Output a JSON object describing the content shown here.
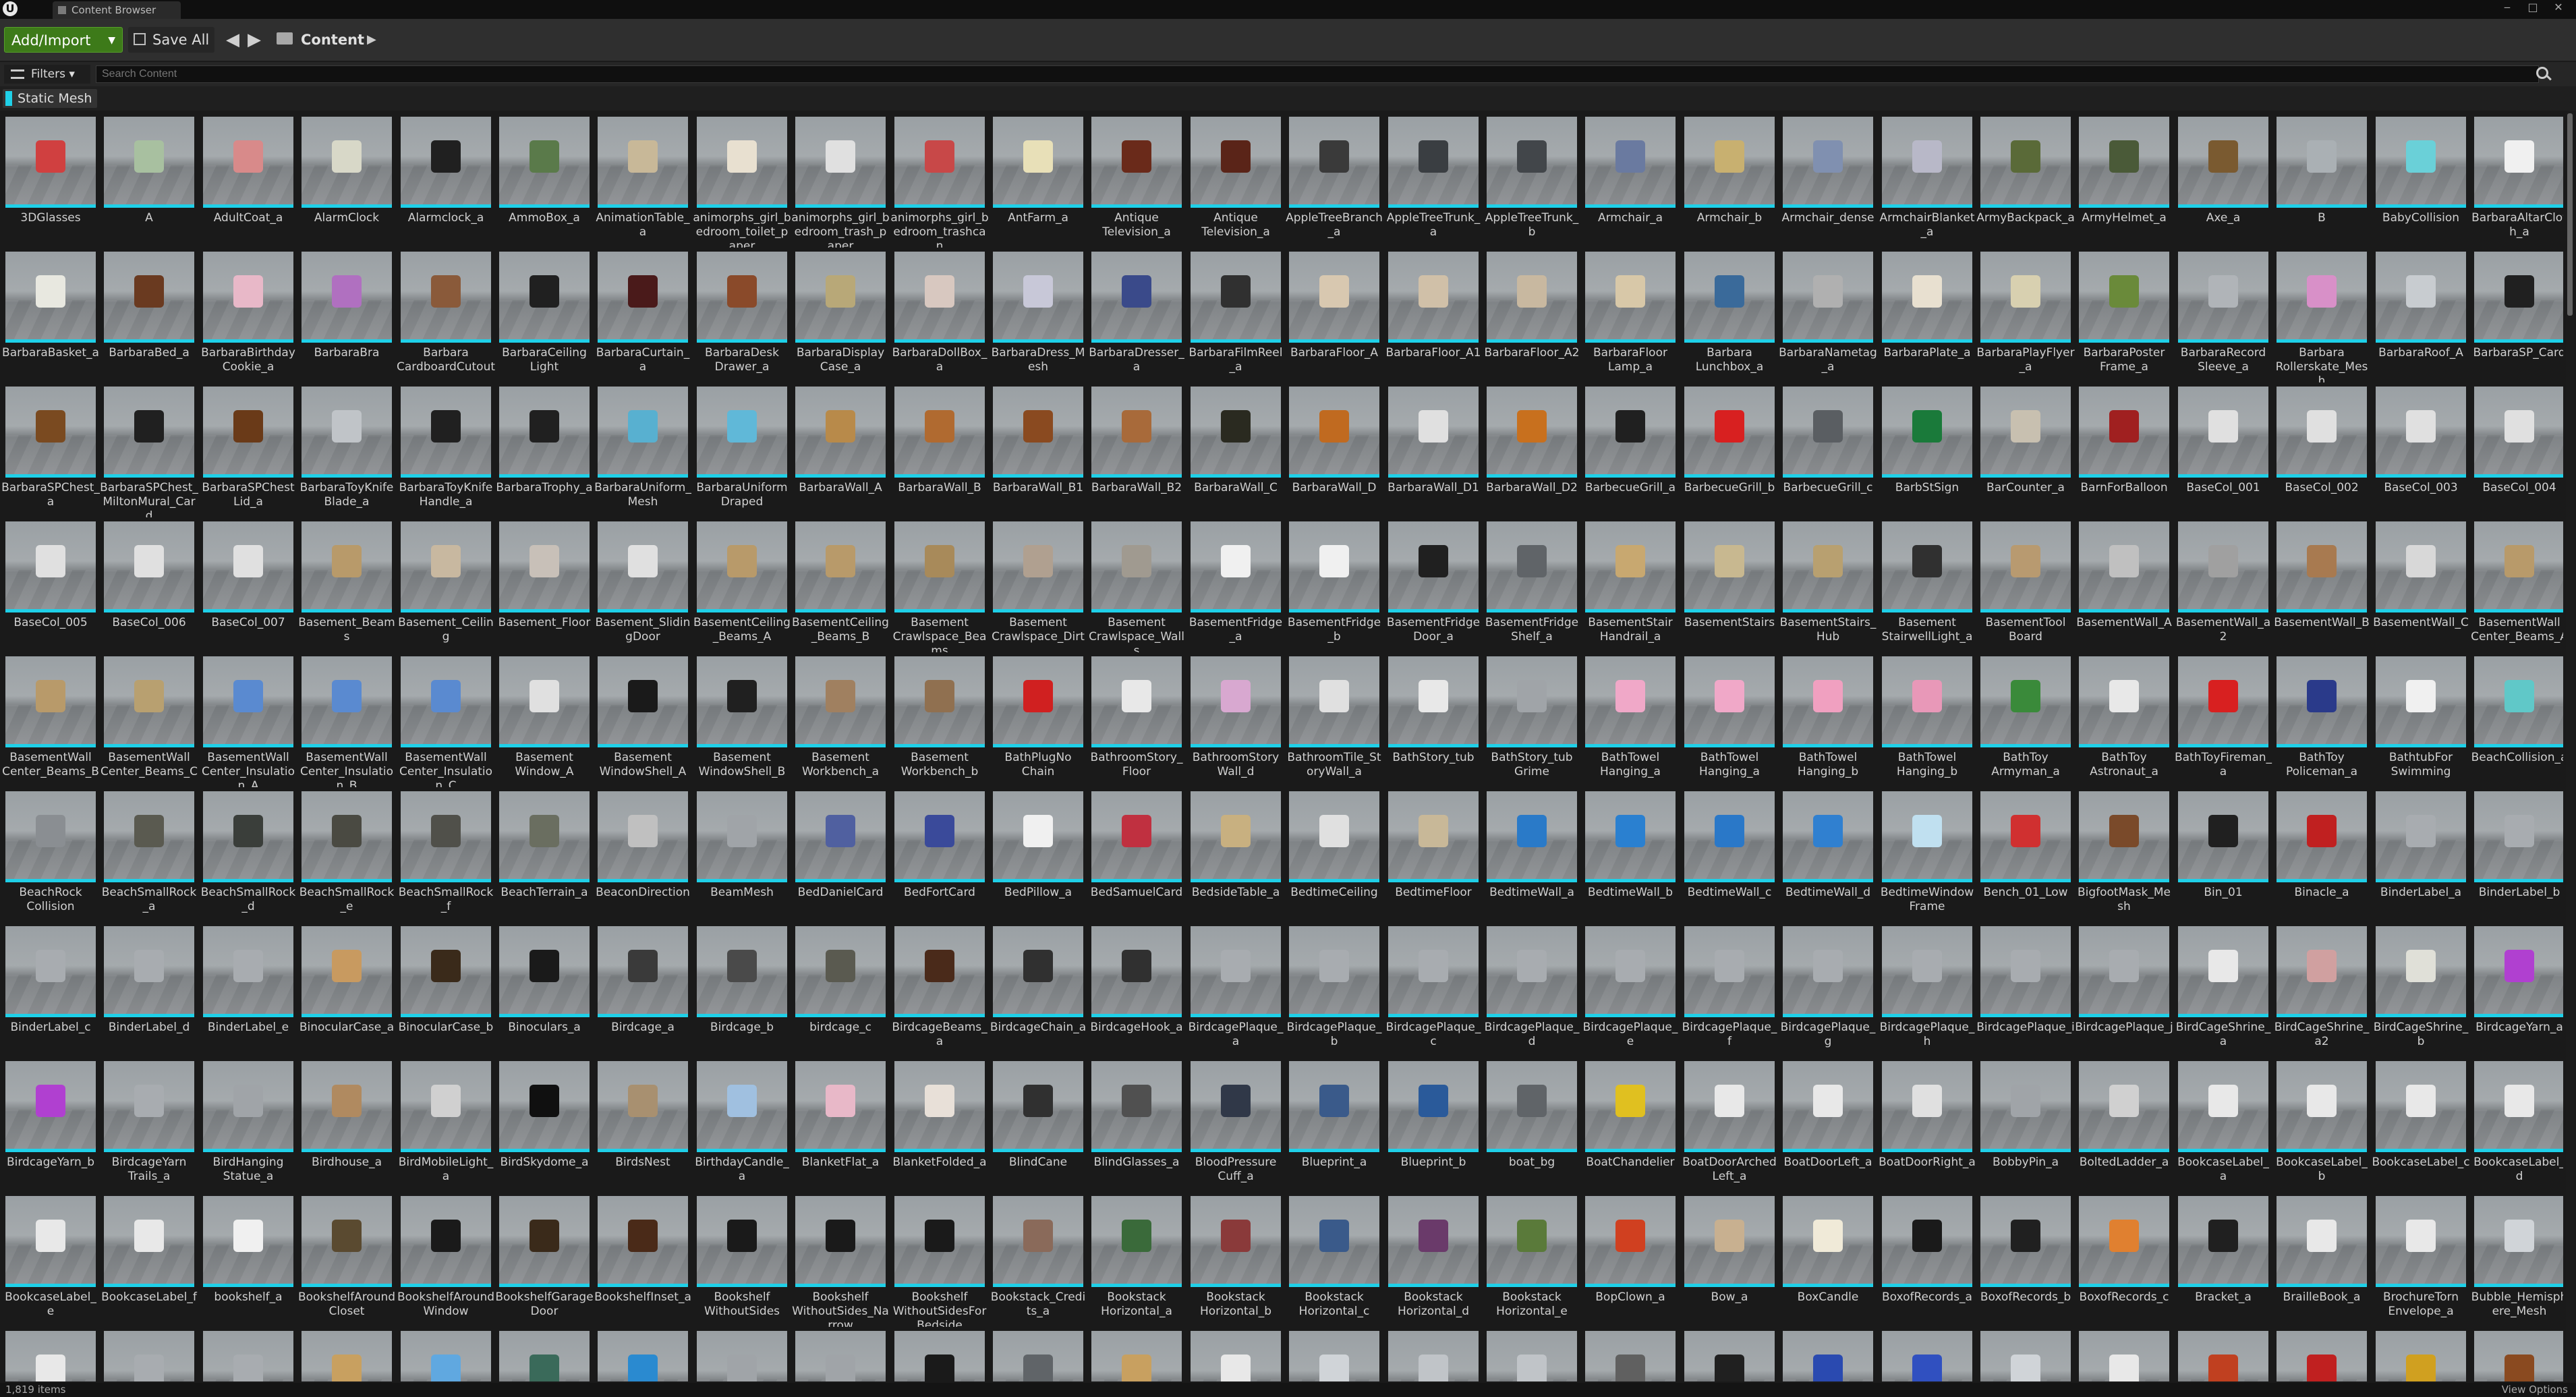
{
  "window": {
    "logo": "U",
    "tab_label": "Content Browser",
    "minimize": "‒",
    "maximize": "□",
    "close": "✕"
  },
  "toolbar": {
    "add_import_label": "Add/Import",
    "save_all_label": "Save All",
    "back": "◀",
    "forward": "▶",
    "path_label": "Content",
    "path_chevron": "▶"
  },
  "filter_bar": {
    "filters_label": "Filters",
    "search_placeholder": "Search Content"
  },
  "active_filter": {
    "label": "Static Mesh",
    "color": "#1fd0e8"
  },
  "assets": [
    {
      "label": "3DGlasses",
      "color": "#d04040"
    },
    {
      "label": "A",
      "color": "#a8c0a0"
    },
    {
      "label": "AdultCoat_a",
      "color": "#d88a8a"
    },
    {
      "label": "AlarmClock",
      "color": "#d8d8c8"
    },
    {
      "label": "Alarmclock_a",
      "color": "#202020"
    },
    {
      "label": "AmmoBox_a",
      "color": "#5a7a4a"
    },
    {
      "label": "AnimationTable_a",
      "color": "#c8b898"
    },
    {
      "label": "animorphs_girl_bedroom_toilet_paper",
      "color": "#e8e0d0"
    },
    {
      "label": "animorphs_girl_bedroom_trash_paper",
      "color": "#e0e0e0"
    },
    {
      "label": "animorphs_girl_bedroom_trashcan",
      "color": "#c84848"
    },
    {
      "label": "AntFarm_a",
      "color": "#e8e0b8"
    },
    {
      "label": "Antique Television_a",
      "color": "#6a2a1a"
    },
    {
      "label": "Antique Television_a",
      "color": "#5a2418"
    },
    {
      "label": "AppleTreeBranch_a",
      "color": "#3a3a3a"
    },
    {
      "label": "AppleTreeTrunk_a",
      "color": "#3a3e42"
    },
    {
      "label": "AppleTreeTrunk_b",
      "color": "#42464a"
    },
    {
      "label": "Armchair_a",
      "color": "#6a7aa0"
    },
    {
      "label": "Armchair_b",
      "color": "#c8b070"
    },
    {
      "label": "Armchair_dense",
      "color": "#8090b0"
    },
    {
      "label": "ArmchairBlanket_a",
      "color": "#b8b8c8"
    },
    {
      "label": "ArmyBackpack_a",
      "color": "#5a6a38"
    },
    {
      "label": "ArmyHelmet_a",
      "color": "#4a5a38"
    },
    {
      "label": "Axe_a",
      "color": "#7a5a30"
    },
    {
      "label": "B",
      "color": "#aab0b4"
    },
    {
      "label": "BabyCollision",
      "color": "#6ad0d8"
    },
    {
      "label": "BarbaraAltarCloth_a",
      "color": "#f0f0f0"
    },
    {
      "label": "BarbaraBasket_a",
      "color": "#e8e8e0"
    },
    {
      "label": "BarbaraBed_a",
      "color": "#6a3a20"
    },
    {
      "label": "BarbaraBirthdayCookie_a",
      "color": "#e8b8c8"
    },
    {
      "label": "BarbaraBra",
      "color": "#b070c0"
    },
    {
      "label": "Barbara CardboardCutout",
      "color": "#8a5a3a"
    },
    {
      "label": "BarbaraCeiling Light",
      "color": "#202020"
    },
    {
      "label": "BarbaraCurtain_a",
      "color": "#4a1a1a"
    },
    {
      "label": "BarbaraDesk Drawer_a",
      "color": "#8a4a2a"
    },
    {
      "label": "BarbaraDisplay Case_a",
      "color": "#b8a878"
    },
    {
      "label": "BarbaraDollBox_a",
      "color": "#d8c8c0"
    },
    {
      "label": "BarbaraDress_Mesh",
      "color": "#c8c8d8"
    },
    {
      "label": "BarbaraDresser_a",
      "color": "#3a4a8a"
    },
    {
      "label": "BarbaraFilmReel_a",
      "color": "#303030"
    },
    {
      "label": "BarbaraFloor_A",
      "color": "#d8c8b0"
    },
    {
      "label": "BarbaraFloor_A1",
      "color": "#d0c0a8"
    },
    {
      "label": "BarbaraFloor_A2",
      "color": "#c8b8a0"
    },
    {
      "label": "BarbaraFloor Lamp_a",
      "color": "#d8c8a8"
    },
    {
      "label": "Barbara Lunchbox_a",
      "color": "#3a6a9a"
    },
    {
      "label": "BarbaraNametag_a",
      "color": "#b0b0b0"
    },
    {
      "label": "BarbaraPlate_a",
      "color": "#e8e0d0"
    },
    {
      "label": "BarbaraPlayFlyer_a",
      "color": "#d8d0b0"
    },
    {
      "label": "BarbaraPoster Frame_a",
      "color": "#6a8a3a"
    },
    {
      "label": "BarbaraRecord Sleeve_a",
      "color": "#b0b4b8"
    },
    {
      "label": "Barbara Rollerskate_Mesh",
      "color": "#d890c8"
    },
    {
      "label": "BarbaraRoof_A",
      "color": "#c8ccd0"
    },
    {
      "label": "BarbaraSP_Card",
      "color": "#202020"
    },
    {
      "label": "BarbaraSPChest_a",
      "color": "#7a4a20"
    },
    {
      "label": "BarbaraSPChest_MiltonMural_Card",
      "color": "#202020"
    },
    {
      "label": "BarbaraSPChest Lid_a",
      "color": "#6a3a18"
    },
    {
      "label": "BarbaraToyKnife Blade_a",
      "color": "#c0c4c8"
    },
    {
      "label": "BarbaraToyKnife Handle_a",
      "color": "#202020"
    },
    {
      "label": "BarbaraTrophy_a",
      "color": "#202020"
    },
    {
      "label": "BarbaraUniform_Mesh",
      "color": "#58b0d0"
    },
    {
      "label": "BarbaraUniform Draped",
      "color": "#60b8d8"
    },
    {
      "label": "BarbaraWall_A",
      "color": "#b88a4a"
    },
    {
      "label": "BarbaraWall_B",
      "color": "#b06a30"
    },
    {
      "label": "BarbaraWall_B1",
      "color": "#8a4a20"
    },
    {
      "label": "BarbaraWall_B2",
      "color": "#a86a3a"
    },
    {
      "label": "BarbaraWall_C",
      "color": "#2a2a20"
    },
    {
      "label": "BarbaraWall_D",
      "color": "#c06a20"
    },
    {
      "label": "BarbaraWall_D1",
      "color": "#e0e0e0"
    },
    {
      "label": "BarbaraWall_D2",
      "color": "#c8701e"
    },
    {
      "label": "BarbecueGrill_a",
      "color": "#202020"
    },
    {
      "label": "BarbecueGrill_b",
      "color": "#d82020"
    },
    {
      "label": "BarbecueGrill_c",
      "color": "#5a5e62"
    },
    {
      "label": "BarbStSign",
      "color": "#1a7a3a"
    },
    {
      "label": "BarCounter_a",
      "color": "#c8c0b0"
    },
    {
      "label": "BarnForBalloon",
      "color": "#a02020"
    },
    {
      "label": "BaseCol_001",
      "color": "#e0e0e0"
    },
    {
      "label": "BaseCol_002",
      "color": "#e0e0e0"
    },
    {
      "label": "BaseCol_003",
      "color": "#e0e0e0"
    },
    {
      "label": "BaseCol_004",
      "color": "#e0e0e0"
    },
    {
      "label": "BaseCol_005",
      "color": "#e0e0e0"
    },
    {
      "label": "BaseCol_006",
      "color": "#e0e0e0"
    },
    {
      "label": "BaseCol_007",
      "color": "#e0e0e0"
    },
    {
      "label": "Basement_Beams",
      "color": "#b89a6a"
    },
    {
      "label": "Basement_Ceiling",
      "color": "#c8b8a0"
    },
    {
      "label": "Basement_Floor",
      "color": "#c8c0b8"
    },
    {
      "label": "Basement_SlidingDoor",
      "color": "#e0e0e0"
    },
    {
      "label": "BasementCeiling_Beams_A",
      "color": "#b89a6a"
    },
    {
      "label": "BasementCeiling_Beams_B",
      "color": "#b89a6a"
    },
    {
      "label": "Basement Crawlspace_Beams",
      "color": "#a88a5a"
    },
    {
      "label": "Basement Crawlspace_Dirt",
      "color": "#b0a090"
    },
    {
      "label": "Basement Crawlspace_Walls",
      "color": "#a09a90"
    },
    {
      "label": "BasementFridge_a",
      "color": "#f0f0f0"
    },
    {
      "label": "BasementFridge_b",
      "color": "#f0f0f0"
    },
    {
      "label": "BasementFridge Door_a",
      "color": "#202020"
    },
    {
      "label": "BasementFridge Shelf_a",
      "color": "#606468"
    },
    {
      "label": "BasementStair Handrail_a",
      "color": "#c8a870"
    },
    {
      "label": "BasementStairs",
      "color": "#c8b890"
    },
    {
      "label": "BasementStairs_Hub",
      "color": "#b8a070"
    },
    {
      "label": "Basement StairwellLight_a",
      "color": "#303030"
    },
    {
      "label": "BasementTool Board",
      "color": "#b89a70"
    },
    {
      "label": "BasementWall_A",
      "color": "#c0c0c0"
    },
    {
      "label": "BasementWall_a2",
      "color": "#a0a0a0"
    },
    {
      "label": "BasementWall_B",
      "color": "#a87a50"
    },
    {
      "label": "BasementWall_C",
      "color": "#d8d8d8"
    },
    {
      "label": "BasementWall Center_Beams_A",
      "color": "#b89a6a"
    },
    {
      "label": "BasementWall Center_Beams_B",
      "color": "#b89a6a"
    },
    {
      "label": "BasementWall Center_Beams_C",
      "color": "#b8a070"
    },
    {
      "label": "BasementWall Center_Insulation_A",
      "color": "#5a8ad0"
    },
    {
      "label": "BasementWall Center_Insulation_B",
      "color": "#5a8ad0"
    },
    {
      "label": "BasementWall Center_Insulation_C",
      "color": "#5a8ad0"
    },
    {
      "label": "Basement Window_A",
      "color": "#e0e0e0"
    },
    {
      "label": "Basement WindowShell_A",
      "color": "#1a1a1a"
    },
    {
      "label": "Basement WindowShell_B",
      "color": "#202020"
    },
    {
      "label": "Basement Workbench_a",
      "color": "#a08060"
    },
    {
      "label": "Basement Workbench_b",
      "color": "#907050"
    },
    {
      "label": "BathPlugNo Chain",
      "color": "#d02020"
    },
    {
      "label": "BathroomStory_Floor",
      "color": "#e8e8e8"
    },
    {
      "label": "BathroomStory Wall_d",
      "color": "#d8a8d0"
    },
    {
      "label": "BathroomTile_StoryWall_a",
      "color": "#e0e0e0"
    },
    {
      "label": "BathStory_tub",
      "color": "#e8e8e8"
    },
    {
      "label": "BathStory_tub Grime",
      "color": "#a0a4a8"
    },
    {
      "label": "BathTowel Hanging_a",
      "color": "#f0a8c8"
    },
    {
      "label": "BathTowel Hanging_a",
      "color": "#f0a8c8"
    },
    {
      "label": "BathTowel Hanging_b",
      "color": "#f0a0c0"
    },
    {
      "label": "BathTowel Hanging_b",
      "color": "#e898b8"
    },
    {
      "label": "BathToy Armyman_a",
      "color": "#3a8a3a"
    },
    {
      "label": "BathToy Astronaut_a",
      "color": "#e8e8e8"
    },
    {
      "label": "BathToyFireman_a",
      "color": "#d82020"
    },
    {
      "label": "BathToy Policeman_a",
      "color": "#2a3a8a"
    },
    {
      "label": "BathtubFor Swimming",
      "color": "#f0f0f0"
    },
    {
      "label": "BeachCollision_a",
      "color": "#60c8c8"
    },
    {
      "label": "BeachRock Collision",
      "color": "#8a8e92"
    },
    {
      "label": "BeachSmallRock_a",
      "color": "#5a5a50"
    },
    {
      "label": "BeachSmallRock_d",
      "color": "#3a3e3a"
    },
    {
      "label": "BeachSmallRock_e",
      "color": "#4a4a42"
    },
    {
      "label": "BeachSmallRock_f",
      "color": "#50504a"
    },
    {
      "label": "BeachTerrain_a",
      "color": "#6a6e60"
    },
    {
      "label": "BeaconDirection",
      "color": "#c0c0c0"
    },
    {
      "label": "BeamMesh",
      "color": "#a0a4a8"
    },
    {
      "label": "BedDanielCard",
      "color": "#5060a0"
    },
    {
      "label": "BedFortCard",
      "color": "#3a4a9a"
    },
    {
      "label": "BedPillow_a",
      "color": "#f0f0f0"
    },
    {
      "label": "BedSamuelCard",
      "color": "#c03040"
    },
    {
      "label": "BedsideTable_a",
      "color": "#c8b080"
    },
    {
      "label": "BedtimeCeiling",
      "color": "#e0e0e0"
    },
    {
      "label": "BedtimeFloor",
      "color": "#c8b898"
    },
    {
      "label": "BedtimeWall_a",
      "color": "#2a7ac8"
    },
    {
      "label": "BedtimeWall_b",
      "color": "#2a80d0"
    },
    {
      "label": "BedtimeWall_c",
      "color": "#2a78c8"
    },
    {
      "label": "BedtimeWall_d",
      "color": "#3080d0"
    },
    {
      "label": "BedtimeWindow Frame",
      "color": "#c0e0f0"
    },
    {
      "label": "Bench_01_Low",
      "color": "#d03030"
    },
    {
      "label": "BigfootMask_Mesh",
      "color": "#7a4a2a"
    },
    {
      "label": "Bin_01",
      "color": "#202020"
    },
    {
      "label": "Binacle_a",
      "color": "#c02020"
    },
    {
      "label": "BinderLabel_a",
      "color": "#a8acb0"
    },
    {
      "label": "BinderLabel_b",
      "color": "#a8acb0"
    },
    {
      "label": "BinderLabel_c",
      "color": "#a8acb0"
    },
    {
      "label": "BinderLabel_d",
      "color": "#a8acb0"
    },
    {
      "label": "BinderLabel_e",
      "color": "#a8acb0"
    },
    {
      "label": "BinocularCase_a",
      "color": "#c89a60"
    },
    {
      "label": "BinocularCase_b",
      "color": "#3a2a1a"
    },
    {
      "label": "Binoculars_a",
      "color": "#1a1a1a"
    },
    {
      "label": "Birdcage_a",
      "color": "#3a3a3a"
    },
    {
      "label": "Birdcage_b",
      "color": "#4a4a4a"
    },
    {
      "label": "birdcage_c",
      "color": "#5a5a50"
    },
    {
      "label": "BirdcageBeams_a",
      "color": "#4a2a1a"
    },
    {
      "label": "BirdcageChain_a",
      "color": "#303030"
    },
    {
      "label": "BirdcageHook_a",
      "color": "#303030"
    },
    {
      "label": "BirdcagePlaque_a",
      "color": "#a8acb0"
    },
    {
      "label": "BirdcagePlaque_b",
      "color": "#a8acb0"
    },
    {
      "label": "BirdcagePlaque_c",
      "color": "#a8acb0"
    },
    {
      "label": "BirdcagePlaque_d",
      "color": "#a8acb0"
    },
    {
      "label": "BirdcagePlaque_e",
      "color": "#a8acb0"
    },
    {
      "label": "BirdcagePlaque_f",
      "color": "#a8acb0"
    },
    {
      "label": "BirdcagePlaque_g",
      "color": "#a8acb0"
    },
    {
      "label": "BirdcagePlaque_h",
      "color": "#a8acb0"
    },
    {
      "label": "BirdcagePlaque_i",
      "color": "#a8acb0"
    },
    {
      "label": "BirdcagePlaque_j",
      "color": "#a8acb0"
    },
    {
      "label": "BirdCageShrine_a",
      "color": "#e8e8e8"
    },
    {
      "label": "BirdCageShrine_a2",
      "color": "#d0a0a0"
    },
    {
      "label": "BirdCageShrine_b",
      "color": "#e0e0d8"
    },
    {
      "label": "BirdcageYarn_a",
      "color": "#b040d0"
    },
    {
      "label": "BirdcageYarn_b",
      "color": "#b040d0"
    },
    {
      "label": "BirdcageYarn Trails_a",
      "color": "#a8acb0"
    },
    {
      "label": "BirdHanging Statue_a",
      "color": "#a0a4a8"
    },
    {
      "label": "Birdhouse_a",
      "color": "#b08a60"
    },
    {
      "label": "BirdMobileLight_a",
      "color": "#d0d0d0"
    },
    {
      "label": "BirdSkydome_a",
      "color": "#101010"
    },
    {
      "label": "BirdsNest",
      "color": "#a89070"
    },
    {
      "label": "BirthdayCandle_a",
      "color": "#a0c0e0"
    },
    {
      "label": "BlanketFlat_a",
      "color": "#e8b8c8"
    },
    {
      "label": "BlanketFolded_a",
      "color": "#e8e0d8"
    },
    {
      "label": "BlindCane",
      "color": "#303030"
    },
    {
      "label": "BlindGlasses_a",
      "color": "#505050"
    },
    {
      "label": "BloodPressure Cuff_a",
      "color": "#303848"
    },
    {
      "label": "Blueprint_a",
      "color": "#3a5a8a"
    },
    {
      "label": "Blueprint_b",
      "color": "#2a5a9a"
    },
    {
      "label": "boat_bg",
      "color": "#606468"
    },
    {
      "label": "BoatChandelier",
      "color": "#e0c020"
    },
    {
      "label": "BoatDoorArched Left_a",
      "color": "#e8e8e8"
    },
    {
      "label": "BoatDoorLeft_a",
      "color": "#e8e8e8"
    },
    {
      "label": "BoatDoorRight_a",
      "color": "#e0e0e0"
    },
    {
      "label": "BobbyPin_a",
      "color": "#a0a4a8"
    },
    {
      "label": "BoltedLadder_a",
      "color": "#d0d0d0"
    },
    {
      "label": "BookcaseLabel_a",
      "color": "#e8e8e8"
    },
    {
      "label": "BookcaseLabel_b",
      "color": "#e8e8e8"
    },
    {
      "label": "BookcaseLabel_c",
      "color": "#e8e8e8"
    },
    {
      "label": "BookcaseLabel_d",
      "color": "#e8e8e8"
    },
    {
      "label": "BookcaseLabel_e",
      "color": "#e8e8e8"
    },
    {
      "label": "BookcaseLabel_f",
      "color": "#e8e8e8"
    },
    {
      "label": "bookshelf_a",
      "color": "#f0f0f0"
    },
    {
      "label": "BookshelfAround Closet",
      "color": "#5a4a30"
    },
    {
      "label": "BookshelfAround Window",
      "color": "#1a1a1a"
    },
    {
      "label": "BookshelfGarage Door",
      "color": "#3a2a1a"
    },
    {
      "label": "BookshelfInset_a",
      "color": "#4a2a18"
    },
    {
      "label": "Bookshelf WithoutSides",
      "color": "#1a1a1a"
    },
    {
      "label": "Bookshelf WithoutSides_Narrow",
      "color": "#1a1a1a"
    },
    {
      "label": "Bookshelf WithoutSidesFor Bedside",
      "color": "#1a1a1a"
    },
    {
      "label": "Bookstack_Credits_a",
      "color": "#8a6a5a"
    },
    {
      "label": "Bookstack Horizontal_a",
      "color": "#3a6a3a"
    },
    {
      "label": "Bookstack Horizontal_b",
      "color": "#8a3a3a"
    },
    {
      "label": "Bookstack Horizontal_c",
      "color": "#3a5a8a"
    },
    {
      "label": "Bookstack Horizontal_d",
      "color": "#6a3a6a"
    },
    {
      "label": "Bookstack Horizontal_e",
      "color": "#5a7a3a"
    },
    {
      "label": "BopClown_a",
      "color": "#d04020"
    },
    {
      "label": "Bow_a",
      "color": "#c8b090"
    },
    {
      "label": "BoxCandle",
      "color": "#f0ead8"
    },
    {
      "label": "BoxofRecords_a",
      "color": "#1a1a1a"
    },
    {
      "label": "BoxofRecords_b",
      "color": "#202020"
    },
    {
      "label": "BoxofRecords_c",
      "color": "#e08030"
    },
    {
      "label": "Bracket_a",
      "color": "#202020"
    },
    {
      "label": "BrailleBook_a",
      "color": "#e8e8e8"
    },
    {
      "label": "BrochureTorn Envelope_a",
      "color": "#e8e8e8"
    },
    {
      "label": "Bubble_Hemisphere_Mesh",
      "color": "#d0d4d8"
    },
    {
      "label": "",
      "color": "#e8e8e8"
    },
    {
      "label": "",
      "color": "#a8acb0"
    },
    {
      "label": "",
      "color": "#a8acb0"
    },
    {
      "label": "",
      "color": "#c8a060"
    },
    {
      "label": "",
      "color": "#60a8e0"
    },
    {
      "label": "",
      "color": "#3a6a5a"
    },
    {
      "label": "",
      "color": "#2a8ad0"
    },
    {
      "label": "",
      "color": "#a0a4a8"
    },
    {
      "label": "",
      "color": "#a0a4a8"
    },
    {
      "label": "",
      "color": "#1a1a1a"
    },
    {
      "label": "",
      "color": "#606468"
    },
    {
      "label": "",
      "color": "#c8a060"
    },
    {
      "label": "",
      "color": "#e8e8e8"
    },
    {
      "label": "",
      "color": "#d0d4d8"
    },
    {
      "label": "",
      "color": "#c0c4c8"
    },
    {
      "label": "",
      "color": "#c0c4c8"
    },
    {
      "label": "",
      "color": "#606060"
    },
    {
      "label": "",
      "color": "#202020"
    },
    {
      "label": "",
      "color": "#2a4ab0"
    },
    {
      "label": "",
      "color": "#3050c0"
    },
    {
      "label": "",
      "color": "#d0d4d8"
    },
    {
      "label": "",
      "color": "#e8e8e8"
    },
    {
      "label": "",
      "color": "#c04020"
    },
    {
      "label": "",
      "color": "#c02020"
    },
    {
      "label": "",
      "color": "#d0a020"
    },
    {
      "label": "",
      "color": "#8a4a20"
    }
  ],
  "status": {
    "item_count": "1,819 items",
    "view_options": "View Options"
  }
}
